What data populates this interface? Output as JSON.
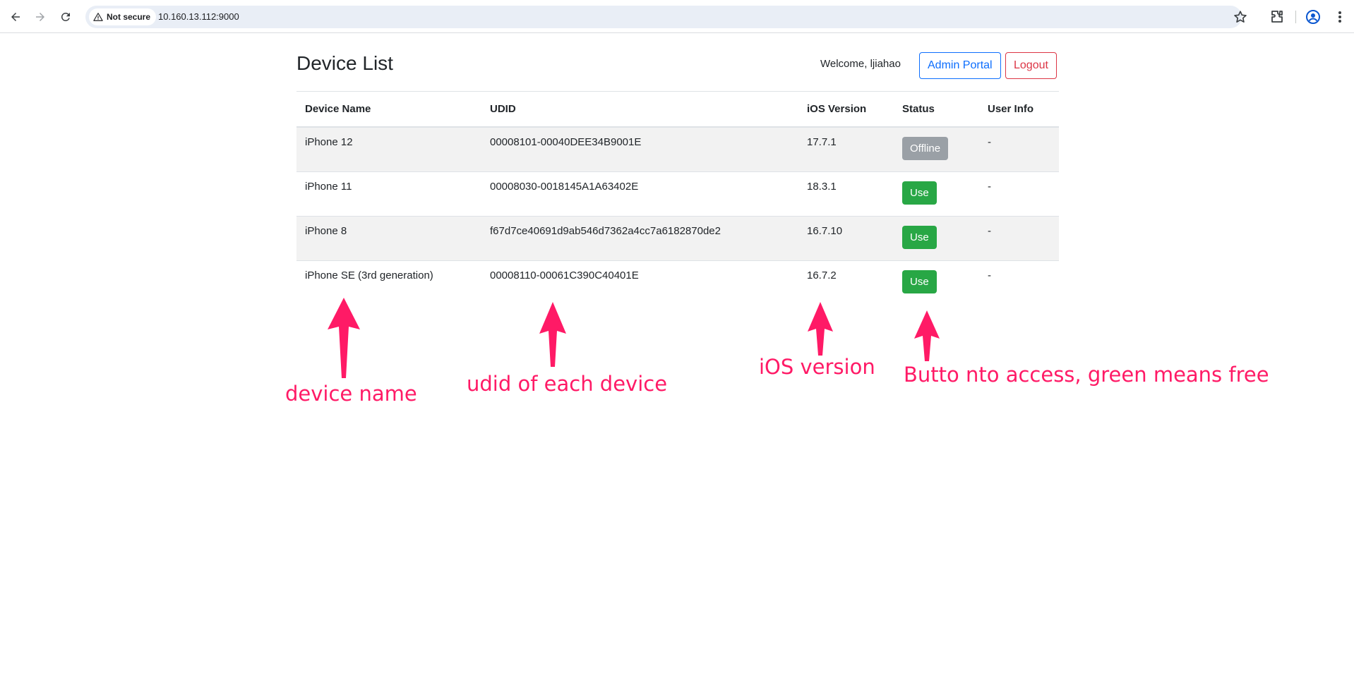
{
  "browser": {
    "security_label": "Not secure",
    "url": "10.160.13.112:9000"
  },
  "header": {
    "title": "Device List",
    "welcome": "Welcome, ljiahao",
    "admin_label": "Admin Portal",
    "logout_label": "Logout"
  },
  "table": {
    "columns": [
      "Device Name",
      "UDID",
      "iOS Version",
      "Status",
      "User Info"
    ],
    "rows": [
      {
        "name": "iPhone 12",
        "udid": "00008101-00040DEE34B9001E",
        "ios": "17.7.1",
        "status": "Offline",
        "user_info": "-"
      },
      {
        "name": "iPhone 11",
        "udid": "00008030-0018145A1A63402E",
        "ios": "18.3.1",
        "status": "Use",
        "user_info": "-"
      },
      {
        "name": "iPhone 8",
        "udid": "f67d7ce40691d9ab546d7362a4cc7a6182870de2",
        "ios": "16.7.10",
        "status": "Use",
        "user_info": "-"
      },
      {
        "name": "iPhone SE (3rd generation)",
        "udid": "00008110-00061C390C40401E",
        "ios": "16.7.2",
        "status": "Use",
        "user_info": "-"
      }
    ]
  },
  "annotations": {
    "device_name": "device name",
    "udid": "udid of each device",
    "ios_version": "iOS version",
    "status": "Butto nto access, green means free"
  },
  "colors": {
    "annotation": "#ff1a66",
    "use_button": "#28a745",
    "offline_button": "#9aa0a6",
    "admin_button": "#0d6efd",
    "logout_button": "#dc3545"
  }
}
